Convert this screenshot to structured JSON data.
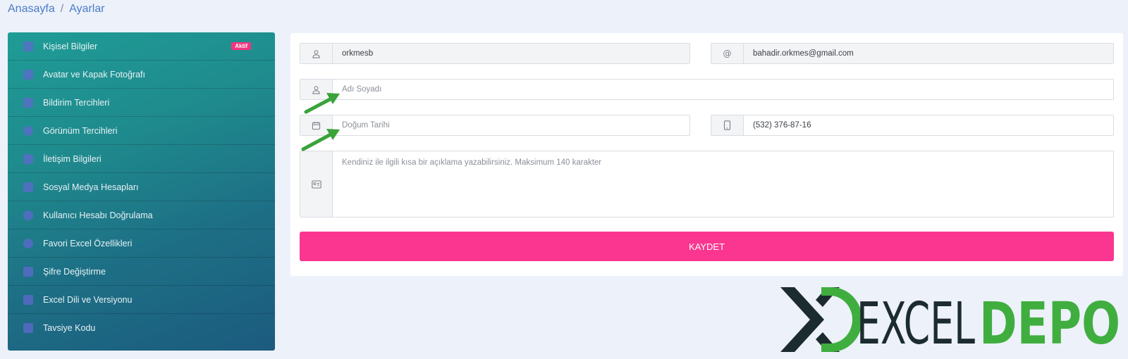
{
  "breadcrumb": {
    "home": "Anasayfa",
    "separator": "/",
    "current": "Ayarlar"
  },
  "sidebar": {
    "items": [
      {
        "label": "Kişisel Bilgiler",
        "icon": "id-card-icon",
        "badge": "Aktif"
      },
      {
        "label": "Avatar ve Kapak Fotoğrafı",
        "icon": "image-icon"
      },
      {
        "label": "Bildirim Tercihleri",
        "icon": "bell-icon"
      },
      {
        "label": "Görünüm Tercihleri",
        "icon": "eye-icon"
      },
      {
        "label": "İletişim Bilgileri",
        "icon": "envelope-icon"
      },
      {
        "label": "Sosyal Medya Hesapları",
        "icon": "share-icon"
      },
      {
        "label": "Kullanıcı Hesabı Doğrulama",
        "icon": "check-circle-icon"
      },
      {
        "label": "Favori Excel Özellikleri",
        "icon": "star-icon"
      },
      {
        "label": "Şifre Değiştirme",
        "icon": "lock-icon"
      },
      {
        "label": "Excel Dili ve Versiyonu",
        "icon": "file-icon"
      },
      {
        "label": "Tavsiye Kodu",
        "icon": "qr-icon"
      }
    ]
  },
  "form": {
    "username": {
      "value": "orkmesb",
      "icon": "user-icon"
    },
    "email": {
      "value": "bahadir.orkmes@gmail.com",
      "icon_text": "@"
    },
    "fullname": {
      "placeholder": "Adı Soyadı",
      "icon": "user-icon"
    },
    "birthdate": {
      "placeholder": "Doğum Tarihi",
      "icon": "calendar-icon"
    },
    "phone": {
      "value": "(532) 376-87-16",
      "icon": "phone-icon"
    },
    "bio": {
      "placeholder": "Kendiniz ile ilgili kısa bir açıklama yazabilirsiniz. Maksimum 140 karakter",
      "icon": "contact-card-icon"
    },
    "save_label": "KAYDET"
  },
  "colors": {
    "accent": "#fa3690",
    "sidebar_start": "#1f9c96",
    "sidebar_end": "#1c5b7e",
    "arrow": "#3aa33a",
    "logo_dark": "#1b2b2f",
    "logo_green": "#3fae3f"
  },
  "logo": {
    "part1": "EXCEL",
    "part2": "DEPO"
  }
}
